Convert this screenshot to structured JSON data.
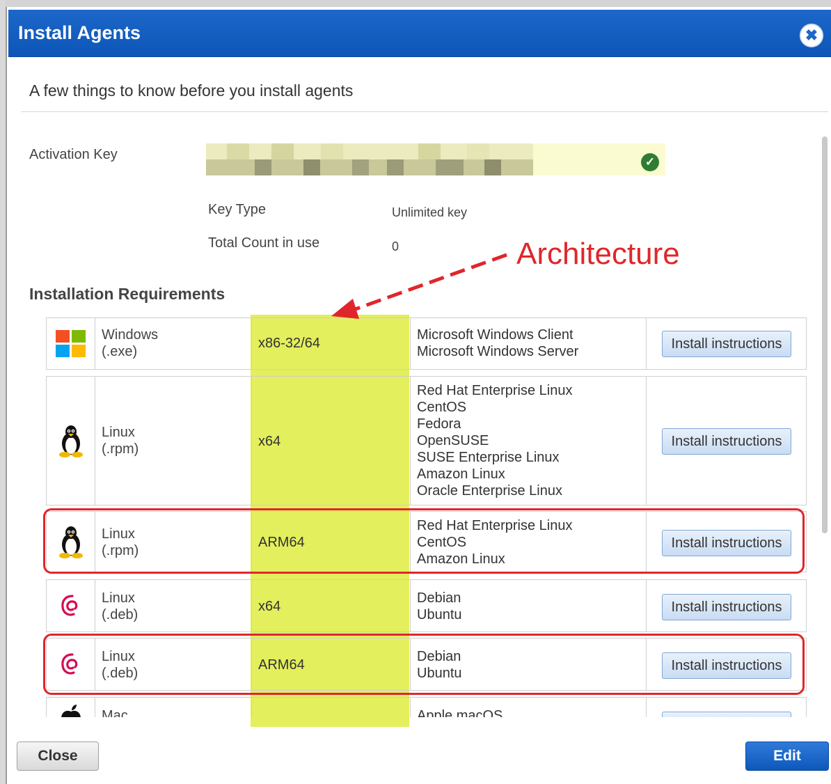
{
  "dialog": {
    "title": "Install Agents",
    "close_icon": "close-icon",
    "subtitle": "A few things to know before you install agents"
  },
  "activation": {
    "label": "Activation Key",
    "status_icon": "check-circle-icon",
    "key_type_label": "Key Type",
    "key_type_value": "Unlimited key",
    "count_label": "Total Count in use",
    "count_value": "0"
  },
  "annotation": {
    "label": "Architecture",
    "color": "#e0262b",
    "highlight_color": "#e3ef5c"
  },
  "requirements": {
    "title": "Installation Requirements",
    "rows": [
      {
        "icon": "windows-logo-icon",
        "type_name": "Windows",
        "type_ext": "(.exe)",
        "arch": "x86-32/64",
        "os": [
          "Microsoft Windows Client",
          "Microsoft Windows Server"
        ],
        "button": "Install instructions",
        "highlighted": false
      },
      {
        "icon": "linux-tux-icon",
        "type_name": "Linux",
        "type_ext": "(.rpm)",
        "arch": "x64",
        "os": [
          "Red Hat Enterprise Linux",
          "CentOS",
          "Fedora",
          "OpenSUSE",
          "SUSE Enterprise Linux",
          "Amazon Linux",
          "Oracle Enterprise Linux"
        ],
        "button": "Install instructions",
        "highlighted": false
      },
      {
        "icon": "linux-tux-icon",
        "type_name": "Linux",
        "type_ext": "(.rpm)",
        "arch": "ARM64",
        "os": [
          "Red Hat Enterprise Linux",
          "CentOS",
          "Amazon Linux"
        ],
        "button": "Install instructions",
        "highlighted": true
      },
      {
        "icon": "debian-swirl-icon",
        "type_name": "Linux",
        "type_ext": "(.deb)",
        "arch": "x64",
        "os": [
          "Debian",
          "Ubuntu"
        ],
        "button": "Install instructions",
        "highlighted": false
      },
      {
        "icon": "debian-swirl-icon",
        "type_name": "Linux",
        "type_ext": "(.deb)",
        "arch": "ARM64",
        "os": [
          "Debian",
          "Ubuntu"
        ],
        "button": "Install instructions",
        "highlighted": true
      },
      {
        "icon": "apple-logo-icon",
        "type_name": "Mac",
        "type_ext": "",
        "arch": "",
        "os": [
          "Apple macOS"
        ],
        "button": "",
        "highlighted": false
      }
    ]
  },
  "footer": {
    "close_label": "Close",
    "edit_label": "Edit"
  }
}
